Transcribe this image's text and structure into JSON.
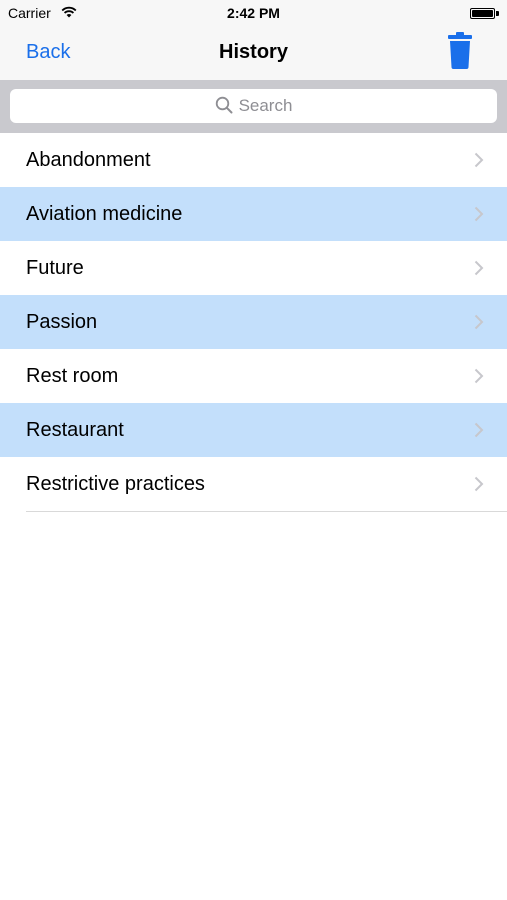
{
  "status_bar": {
    "carrier": "Carrier",
    "time": "2:42 PM"
  },
  "nav": {
    "back_label": "Back",
    "title": "History",
    "trash_icon": "trash-icon",
    "accent_color": "#1a6fea"
  },
  "search": {
    "placeholder": "Search"
  },
  "history": {
    "items": [
      {
        "label": "Abandonment",
        "highlighted": false
      },
      {
        "label": "Aviation medicine",
        "highlighted": true
      },
      {
        "label": "Future",
        "highlighted": false
      },
      {
        "label": "Passion",
        "highlighted": true
      },
      {
        "label": "Rest room",
        "highlighted": false
      },
      {
        "label": "Restaurant",
        "highlighted": true
      },
      {
        "label": "Restrictive practices",
        "highlighted": false
      }
    ],
    "highlight_color": "#c3dffb"
  }
}
